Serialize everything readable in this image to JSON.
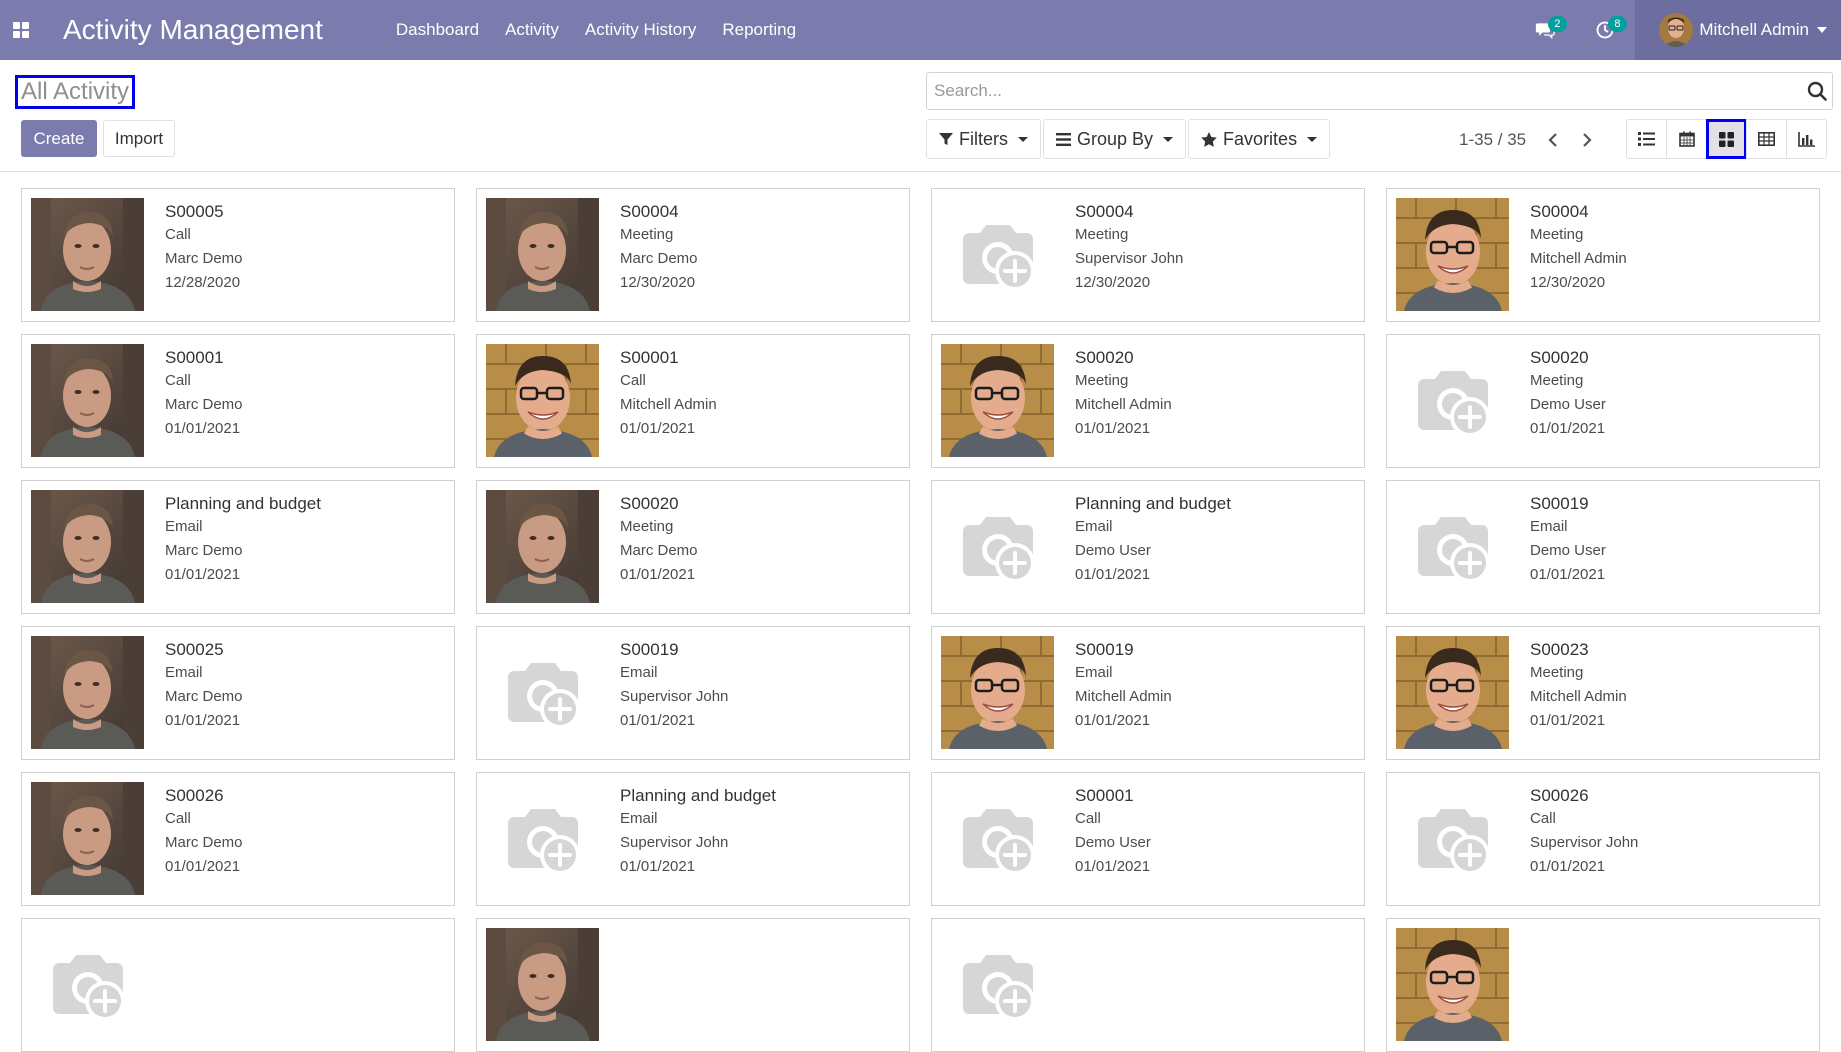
{
  "navbar": {
    "app_title": "Activity Management",
    "menu": [
      "Dashboard",
      "Activity",
      "Activity History",
      "Reporting"
    ],
    "messages_count": "2",
    "activities_count": "8",
    "user_name": "Mitchell Admin",
    "bg_color": "#7c7bad"
  },
  "control": {
    "breadcrumb": "All Activity",
    "create_label": "Create",
    "import_label": "Import",
    "search_placeholder": "Search...",
    "filters_label": "Filters",
    "groupby_label": "Group By",
    "favorites_label": "Favorites",
    "pager": "1-35 / 35",
    "views": [
      "list-view-icon",
      "calendar-view-icon",
      "kanban-view-icon",
      "pivot-view-icon",
      "graph-view-icon"
    ],
    "active_view": "kanban"
  },
  "cards": [
    {
      "ref": "S00005",
      "type": "Call",
      "user": "Marc Demo",
      "date": "12/28/2020",
      "avatar": "marc"
    },
    {
      "ref": "S00004",
      "type": "Meeting",
      "user": "Marc Demo",
      "date": "12/30/2020",
      "avatar": "marc"
    },
    {
      "ref": "S00004",
      "type": "Meeting",
      "user": "Supervisor John",
      "date": "12/30/2020",
      "avatar": "placeholder"
    },
    {
      "ref": "S00004",
      "type": "Meeting",
      "user": "Mitchell Admin",
      "date": "12/30/2020",
      "avatar": "mitchell"
    },
    {
      "ref": "S00001",
      "type": "Call",
      "user": "Marc Demo",
      "date": "01/01/2021",
      "avatar": "marc"
    },
    {
      "ref": "S00001",
      "type": "Call",
      "user": "Mitchell Admin",
      "date": "01/01/2021",
      "avatar": "mitchell"
    },
    {
      "ref": "S00020",
      "type": "Meeting",
      "user": "Mitchell Admin",
      "date": "01/01/2021",
      "avatar": "mitchell"
    },
    {
      "ref": "S00020",
      "type": "Meeting",
      "user": "Demo User",
      "date": "01/01/2021",
      "avatar": "placeholder"
    },
    {
      "ref": "Planning and budget",
      "type": "Email",
      "user": "Marc Demo",
      "date": "01/01/2021",
      "avatar": "marc"
    },
    {
      "ref": "S00020",
      "type": "Meeting",
      "user": "Marc Demo",
      "date": "01/01/2021",
      "avatar": "marc"
    },
    {
      "ref": "Planning and budget",
      "type": "Email",
      "user": "Demo User",
      "date": "01/01/2021",
      "avatar": "placeholder"
    },
    {
      "ref": "S00019",
      "type": "Email",
      "user": "Demo User",
      "date": "01/01/2021",
      "avatar": "placeholder"
    },
    {
      "ref": "S00025",
      "type": "Email",
      "user": "Marc Demo",
      "date": "01/01/2021",
      "avatar": "marc"
    },
    {
      "ref": "S00019",
      "type": "Email",
      "user": "Supervisor John",
      "date": "01/01/2021",
      "avatar": "placeholder"
    },
    {
      "ref": "S00019",
      "type": "Email",
      "user": "Mitchell Admin",
      "date": "01/01/2021",
      "avatar": "mitchell"
    },
    {
      "ref": "S00023",
      "type": "Meeting",
      "user": "Mitchell Admin",
      "date": "01/01/2021",
      "avatar": "mitchell"
    },
    {
      "ref": "S00026",
      "type": "Call",
      "user": "Marc Demo",
      "date": "01/01/2021",
      "avatar": "marc"
    },
    {
      "ref": "Planning and budget",
      "type": "Email",
      "user": "Supervisor John",
      "date": "01/01/2021",
      "avatar": "placeholder"
    },
    {
      "ref": "S00001",
      "type": "Call",
      "user": "Demo User",
      "date": "01/01/2021",
      "avatar": "placeholder"
    },
    {
      "ref": "S00026",
      "type": "Call",
      "user": "Supervisor John",
      "date": "01/01/2021",
      "avatar": "placeholder"
    },
    {
      "ref": "",
      "type": "",
      "user": "",
      "date": "",
      "avatar": "placeholder"
    },
    {
      "ref": "",
      "type": "",
      "user": "",
      "date": "",
      "avatar": "marc"
    },
    {
      "ref": "",
      "type": "",
      "user": "",
      "date": "",
      "avatar": "placeholder"
    },
    {
      "ref": "",
      "type": "",
      "user": "",
      "date": "",
      "avatar": "mitchell"
    }
  ]
}
